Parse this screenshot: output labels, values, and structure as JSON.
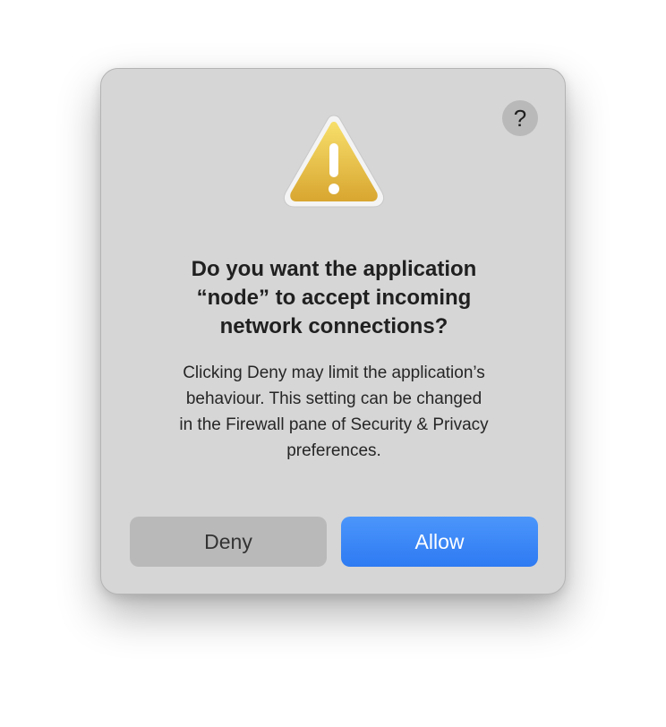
{
  "dialog": {
    "help_label": "?",
    "title_lines": [
      "Do you want the application",
      "“node” to accept incoming",
      "network connections?"
    ],
    "message_lines": [
      "Clicking Deny may limit the application’s",
      "behaviour. This setting can be changed",
      "in the Firewall pane of Security & Privacy",
      "preferences."
    ],
    "icon": "warning-triangle-icon",
    "buttons": {
      "deny_label": "Deny",
      "allow_label": "Allow"
    }
  },
  "colors": {
    "dialog_background": "#d6d6d6",
    "allow_button": "#3585f6",
    "deny_button": "#b9b9b9",
    "warning_yellow": "#e6b93a"
  }
}
